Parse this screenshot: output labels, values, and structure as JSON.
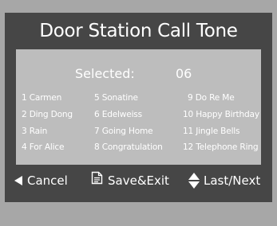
{
  "screen": {
    "title": "Door Station Call Tone"
  },
  "selected": {
    "label": "Selected:",
    "value": "06"
  },
  "tones": [
    "1 Carmen",
    "2 Ding Dong",
    "3 Rain",
    "4 For Alice",
    "5 Sonatine",
    "6 Edelweiss",
    "7 Going Home",
    "8 Congratulation",
    "9 Do Re Me",
    "10 Happy Birthday",
    "11 Jingle Bells",
    "12 Telephone Ring"
  ],
  "footer": {
    "cancel_label": "Cancel",
    "save_label": "Save&Exit",
    "nav_label": "Last/Next"
  },
  "colors": {
    "screen_bg": "#464646",
    "panel_bg": "#bdbdbd",
    "text": "#ffffff"
  },
  "icons": {
    "cancel": "left-triangle-icon",
    "save": "document-icon",
    "nav": "up-down-arrows-icon"
  }
}
